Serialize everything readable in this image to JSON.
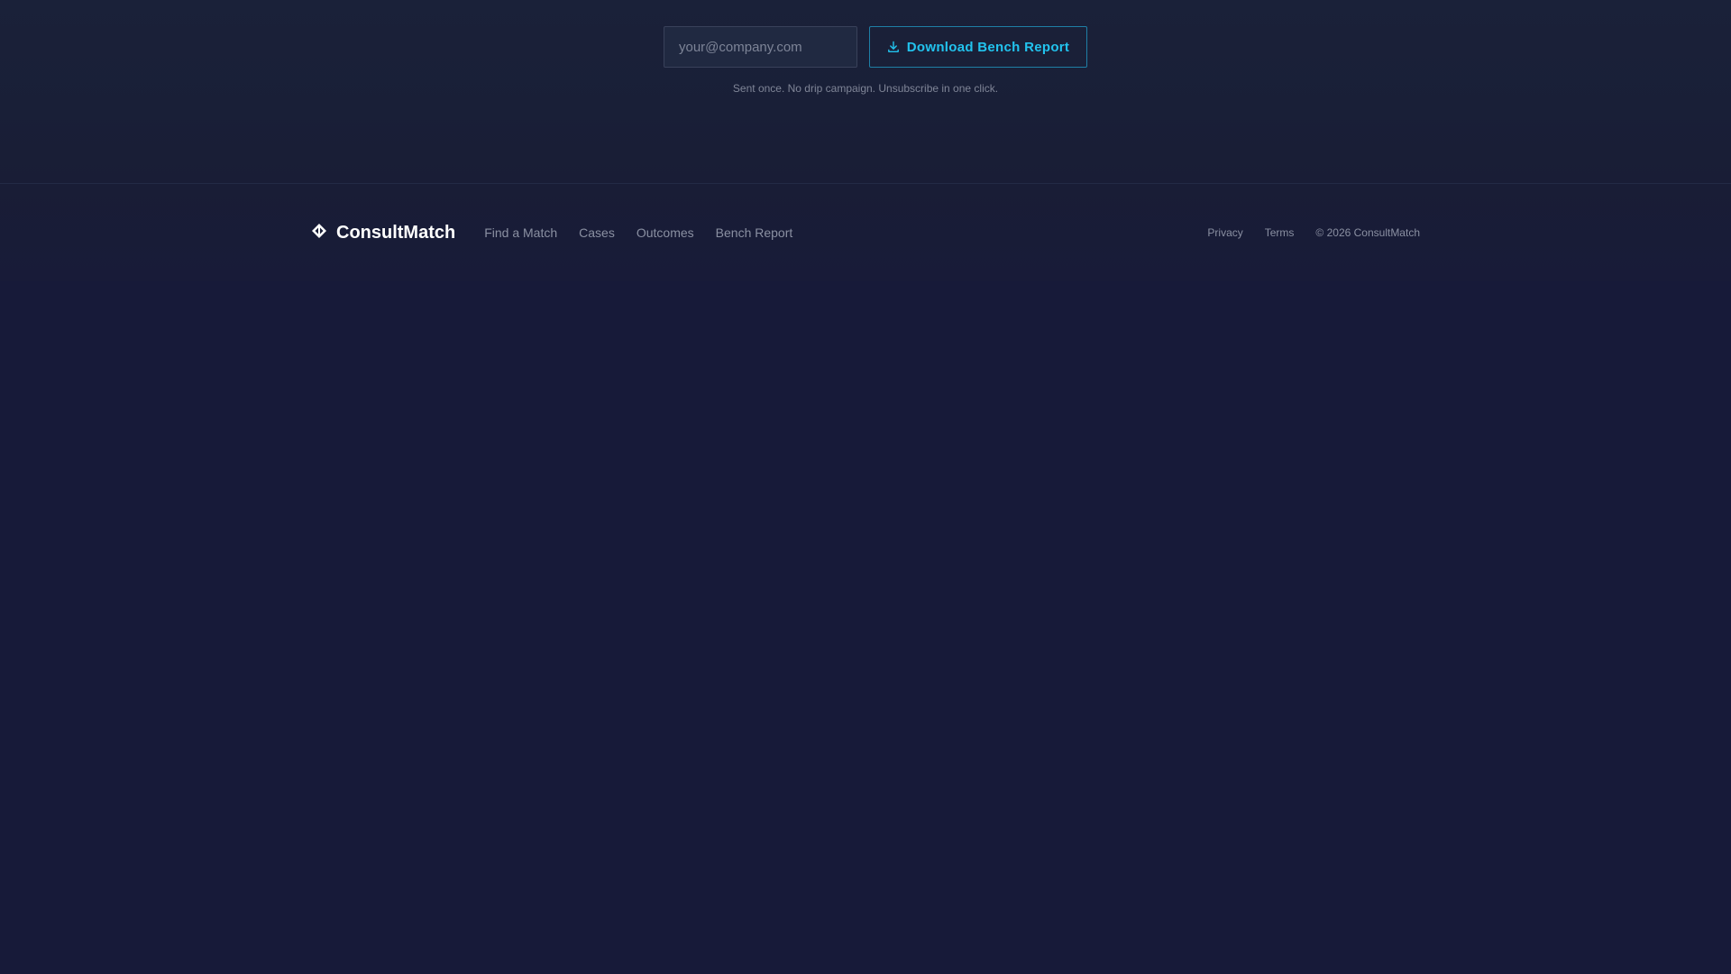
{
  "signup": {
    "email_placeholder": "your@company.com",
    "email_value": "",
    "download_label": "Download Bench Report",
    "download_icon": "download-icon",
    "fine_print": "Sent once. No drip campaign. Unsubscribe in one click."
  },
  "footer": {
    "brand_name": "ConsultMatch",
    "logo_icon": "diamond-arrows-icon",
    "nav": [
      {
        "label": "Find a Match"
      },
      {
        "label": "Cases"
      },
      {
        "label": "Outcomes"
      },
      {
        "label": "Bench Report"
      }
    ],
    "legal": {
      "privacy": "Privacy",
      "terms": "Terms",
      "copyright": "© 2026 ConsultMatch"
    }
  },
  "colors": {
    "background": "#171a39",
    "accent": "#22c3ee",
    "accent_border": "#1f7fa6",
    "muted_text": "#8a90a2"
  }
}
